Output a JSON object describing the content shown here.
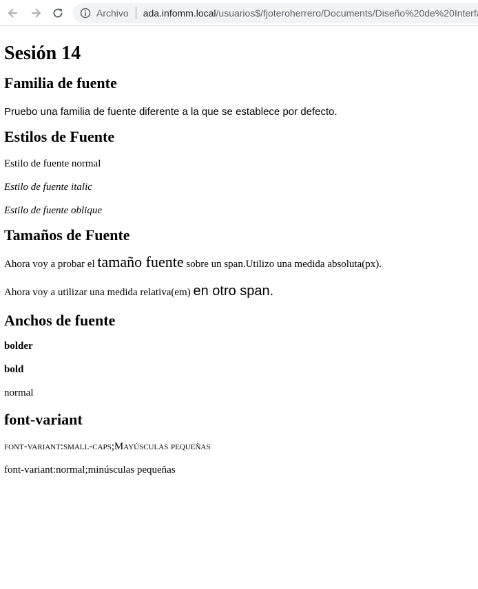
{
  "browser": {
    "scheme_label": "Archivo",
    "host": "ada.infomm.local",
    "path": "/usuarios$/fjoteroherrero/Documents/Diseño%20de%20Interfa"
  },
  "page": {
    "title": "Sesión 14",
    "sections": {
      "familia": {
        "heading": "Familia de fuente",
        "text": "Pruebo una familia de fuente diferente a la que se establece por defecto."
      },
      "estilos": {
        "heading": "Estilos de Fuente",
        "normal": "Estilo de fuente normal",
        "italic": "Estilo de fuente italic",
        "oblique": "Estilo de fuente oblique"
      },
      "tamanos": {
        "heading": "Tamaños de Fuente",
        "line1_a": "Ahora voy a probar el ",
        "line1_span": "tamaño fuente",
        "line1_b": " sobre un span.Utilizo una medida absoluta(px).",
        "line2_a": "Ahora voy a utilizar una medida relativa(em) ",
        "line2_span": "en otro span."
      },
      "anchos": {
        "heading": "Anchos de fuente",
        "bolder": "bolder",
        "bold": "bold",
        "normal": "normal"
      },
      "variant": {
        "heading": "font-variant",
        "small_caps": "font-variant:small-caps;Mayúsculas pequeñas",
        "normal": "font-variant:normal;minúsculas pequeñas"
      }
    }
  }
}
